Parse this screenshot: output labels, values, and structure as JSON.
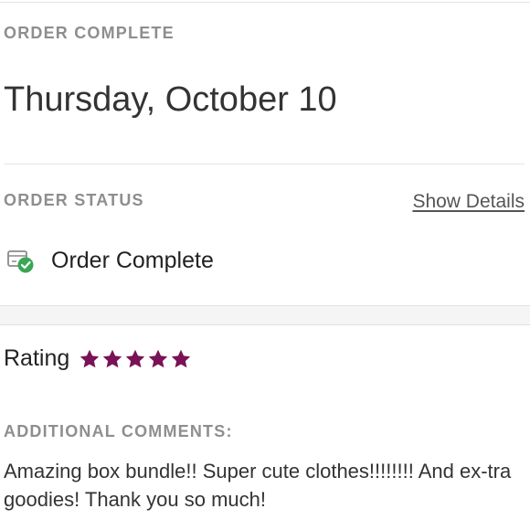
{
  "order": {
    "complete_label": "ORDER COMPLETE",
    "date": "Thursday, October 10"
  },
  "status": {
    "section_label": "ORDER STATUS",
    "show_details_label": "Show Details",
    "status_text": "Order Complete",
    "status_icon": "package-check-icon"
  },
  "rating": {
    "label": "Rating",
    "stars": 5,
    "max_stars": 5,
    "star_color": "#7a1257"
  },
  "comments": {
    "section_label": "ADDITIONAL COMMENTS:",
    "text": "Amazing box bundle!! Super cute clothes!!!!!!!! And ex-tra goodies! Thank you so much!"
  },
  "colors": {
    "success_green": "#3aa655",
    "label_gray": "#8e8e8e"
  }
}
